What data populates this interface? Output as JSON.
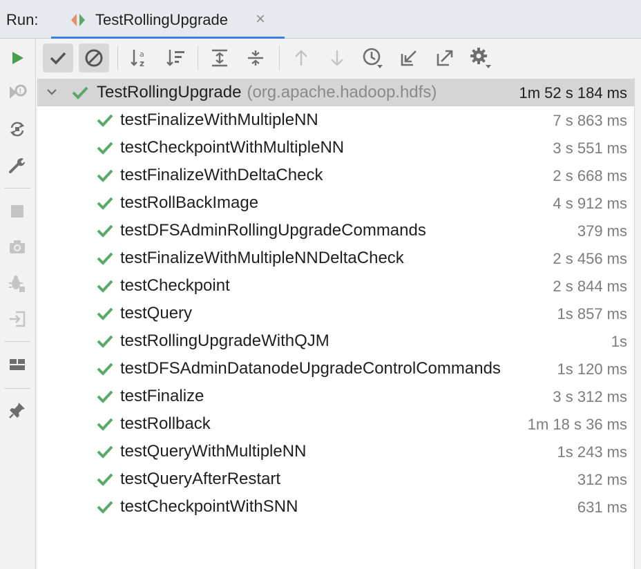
{
  "header": {
    "run_label": "Run:",
    "tab_title": "TestRollingUpgrade",
    "close_symbol": "×"
  },
  "left_toolbar": {
    "buttons": [
      "run-icon",
      "rerun-failed-icon",
      "toggle-auto-test-icon",
      "settings-wrench-icon",
      "stop-icon",
      "snapshot-icon",
      "debug-icon",
      "exit-icon",
      "layout-icon",
      "pin-icon"
    ]
  },
  "toolbar": {
    "buttons": [
      "show-passed-icon",
      "show-ignored-icon",
      "sort-alphabetically-icon",
      "sort-by-duration-icon",
      "expand-all-icon",
      "collapse-all-icon",
      "previous-failed-icon",
      "next-failed-icon",
      "test-history-icon",
      "import-tests-icon",
      "export-tests-icon",
      "settings-gear-icon"
    ]
  },
  "tree": {
    "root": {
      "name": "TestRollingUpgrade",
      "package": "(org.apache.hadoop.hdfs)",
      "duration": "1m 52 s 184 ms",
      "status": "passed"
    },
    "tests": [
      {
        "name": "testFinalizeWithMultipleNN",
        "duration": "7 s 863 ms"
      },
      {
        "name": "testCheckpointWithMultipleNN",
        "duration": "3 s 551 ms"
      },
      {
        "name": "testFinalizeWithDeltaCheck",
        "duration": "2 s 668 ms"
      },
      {
        "name": "testRollBackImage",
        "duration": "4 s 912 ms"
      },
      {
        "name": "testDFSAdminRollingUpgradeCommands",
        "duration": "379 ms"
      },
      {
        "name": "testFinalizeWithMultipleNNDeltaCheck",
        "duration": "2 s 456 ms"
      },
      {
        "name": "testCheckpoint",
        "duration": "2 s 844 ms"
      },
      {
        "name": "testQuery",
        "duration": "1s 857 ms"
      },
      {
        "name": "testRollingUpgradeWithQJM",
        "duration": "1s"
      },
      {
        "name": "testDFSAdminDatanodeUpgradeControlCommands",
        "duration": "1s 120 ms"
      },
      {
        "name": "testFinalize",
        "duration": "3 s 312 ms"
      },
      {
        "name": "testRollback",
        "duration": "1m 18 s 36 ms"
      },
      {
        "name": "testQueryWithMultipleNN",
        "duration": "1s 243 ms"
      },
      {
        "name": "testQueryAfterRestart",
        "duration": "312 ms"
      },
      {
        "name": "testCheckpointWithSNN",
        "duration": "631 ms"
      }
    ]
  },
  "colors": {
    "pass_green": "#59a869",
    "accent_blue": "#3d7ddb",
    "run_green": "#4aa04a",
    "icon_gray": "#6e6e6e"
  }
}
